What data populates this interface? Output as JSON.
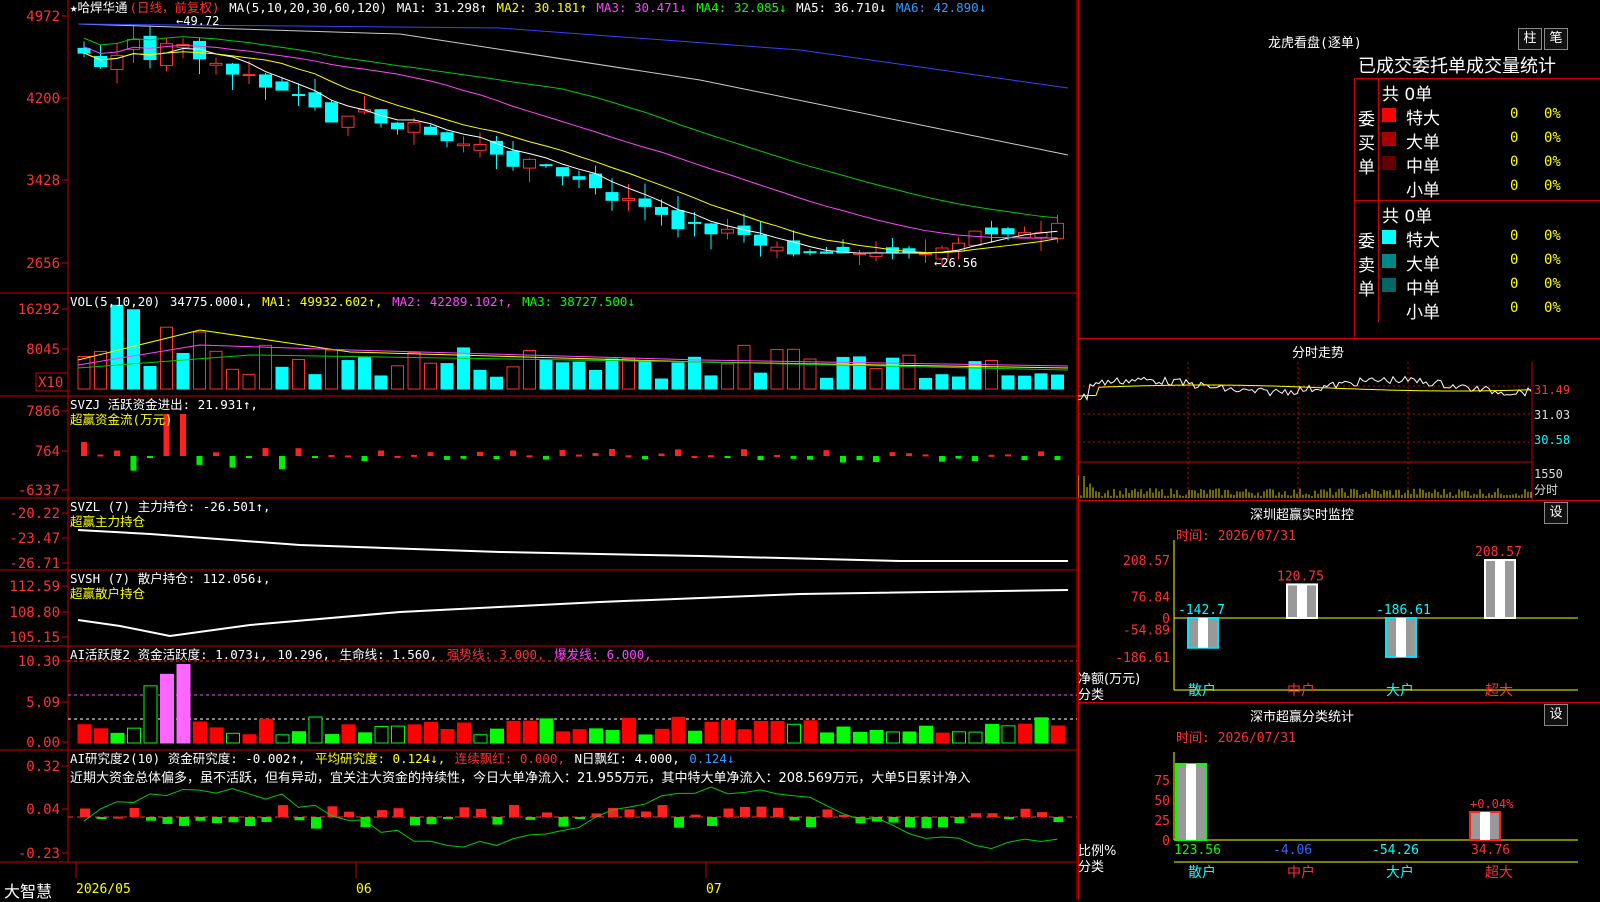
{
  "stock": {
    "name": "★哈焊华通",
    "mode": "(日线，前复权)",
    "high_label": "←49.72",
    "low_label": "←26.56"
  },
  "price_axis": [
    "4972",
    "4200",
    "3428",
    "2656"
  ],
  "ma_header": {
    "prefix": "MA(5,10,20,30,60,120)",
    "items": [
      {
        "label": "MA1: 31.298↑",
        "color": "#ffffff"
      },
      {
        "label": "MA2: 30.181↑",
        "color": "#ffff00"
      },
      {
        "label": "MA3: 30.471↓",
        "color": "#ff44ff"
      },
      {
        "label": "MA4: 32.085↓",
        "color": "#00ff00"
      },
      {
        "label": "MA5: 36.710↓",
        "color": "#dddddd"
      },
      {
        "label": "MA6: 42.890↓",
        "color": "#3399ff"
      }
    ]
  },
  "vol_panel": {
    "prefix": "VOL(5,10,20)",
    "value": "34775.000↓,",
    "ma1": "MA1: 49932.602↑,",
    "ma2": "MA2: 42289.102↑,",
    "ma3": "MA3: 38727.500↓",
    "axis": [
      "16292",
      "8045"
    ],
    "unit": "X10"
  },
  "svzj_panel": {
    "line1": "SVZJ  活跃资金进出: 21.931↑,",
    "line2": "超赢资金流(万元)",
    "axis": [
      "7866",
      "764",
      "-6337"
    ]
  },
  "svzl_panel": {
    "line1": "SVZL (7) 主力持仓: -26.501↑,",
    "line2": "超赢主力持仓",
    "axis": [
      "-20.22",
      "-23.47",
      "-26.71"
    ]
  },
  "svsh_panel": {
    "line1": "SVSH (7) 散户持仓: 112.056↓,",
    "line2": "超赢散户持仓",
    "axis": [
      "112.59",
      "108.80",
      "105.15"
    ]
  },
  "ai_active_panel": {
    "prefix": "AI活跃度2 资金活跃度: 1.073↓,",
    "v2": "10.296,",
    "v3": "生命线: 1.560,",
    "v4": "强势线: 3.000,",
    "v5": "爆发线: 6.000,",
    "axis": [
      "10.30",
      "5.09",
      "0.00"
    ]
  },
  "ai_research_panel": {
    "prefix": "AI研究度2(10) 资金研究度: -0.002↑,",
    "v2": "平均研究度: 0.124↓,",
    "v3": "连续飘红: 0.000,",
    "v4": "N日飘红: 4.000,",
    "v5": "0.124↓",
    "comment": "近期大资金总体偏多，虽不活跃，但有异动，宜关注大资金的持续性，今日大单净流入：21.955万元，其中特大单净流入：208.569万元，大单5日累计净入",
    "axis": [
      "0.32",
      "0.04",
      "-0.23"
    ]
  },
  "bottom_bar": {
    "logo": "大智慧",
    "dates": [
      "2026/05",
      "06",
      "07"
    ]
  },
  "right_panel": {
    "title": "龙虎看盘(逐单)",
    "tab_bar": "柱",
    "tab_detail": "笔",
    "subtitle": "已成交委托单成交量统计",
    "buy_side": {
      "label": "委买单",
      "total": "共 0单",
      "rows": [
        {
          "name": "特大",
          "qty": "0",
          "pct": "0%",
          "color": "#ff0000"
        },
        {
          "name": "大单",
          "qty": "0",
          "pct": "0%",
          "color": "#aa0000"
        },
        {
          "name": "中单",
          "qty": "0",
          "pct": "0%",
          "color": "#660000"
        },
        {
          "name": "小单",
          "qty": "0",
          "pct": "0%",
          "color": "#000000"
        }
      ]
    },
    "sell_side": {
      "label": "委卖单",
      "total": "共 0单",
      "rows": [
        {
          "name": "特大",
          "qty": "0",
          "pct": "0%",
          "color": "#00ffff"
        },
        {
          "name": "大单",
          "qty": "0",
          "pct": "0%",
          "color": "#008888"
        },
        {
          "name": "中单",
          "qty": "0",
          "pct": "0%",
          "color": "#006666"
        },
        {
          "name": "小单",
          "qty": "0",
          "pct": "0%",
          "color": "#000000"
        }
      ]
    },
    "intraday": {
      "title": "分时走势",
      "axis": [
        "31.49",
        "31.03",
        "30.58",
        "1550"
      ],
      "footer": "分时"
    },
    "monitor": {
      "title": "深圳超赢实时监控",
      "settings": "设",
      "time": "时间: 2026/07/31",
      "axis": [
        "208.57",
        "76.84",
        "0",
        "-54.89",
        "-186.61"
      ],
      "ylabel": "净额(万元)",
      "xlabel": "分类",
      "categories": [
        "散户",
        "中户",
        "大户",
        "超大"
      ],
      "values": [
        -142.7,
        120.75,
        -186.61,
        208.57
      ],
      "value_labels": [
        "-142.7",
        "120.75",
        "-186.61",
        "208.57"
      ]
    },
    "stats": {
      "title": "深市超赢分类统计",
      "settings": "设",
      "time": "时间: 2026/07/31",
      "axis": [
        "75",
        "50",
        "25",
        "0"
      ],
      "ylabel": "比例%",
      "xlabel": "分类",
      "categories": [
        "散户",
        "中户",
        "大户",
        "超大"
      ],
      "values": [
        "123.56",
        "-4.06",
        "-54.26",
        "34.76"
      ],
      "extra_label": "+0.04%"
    }
  }
}
